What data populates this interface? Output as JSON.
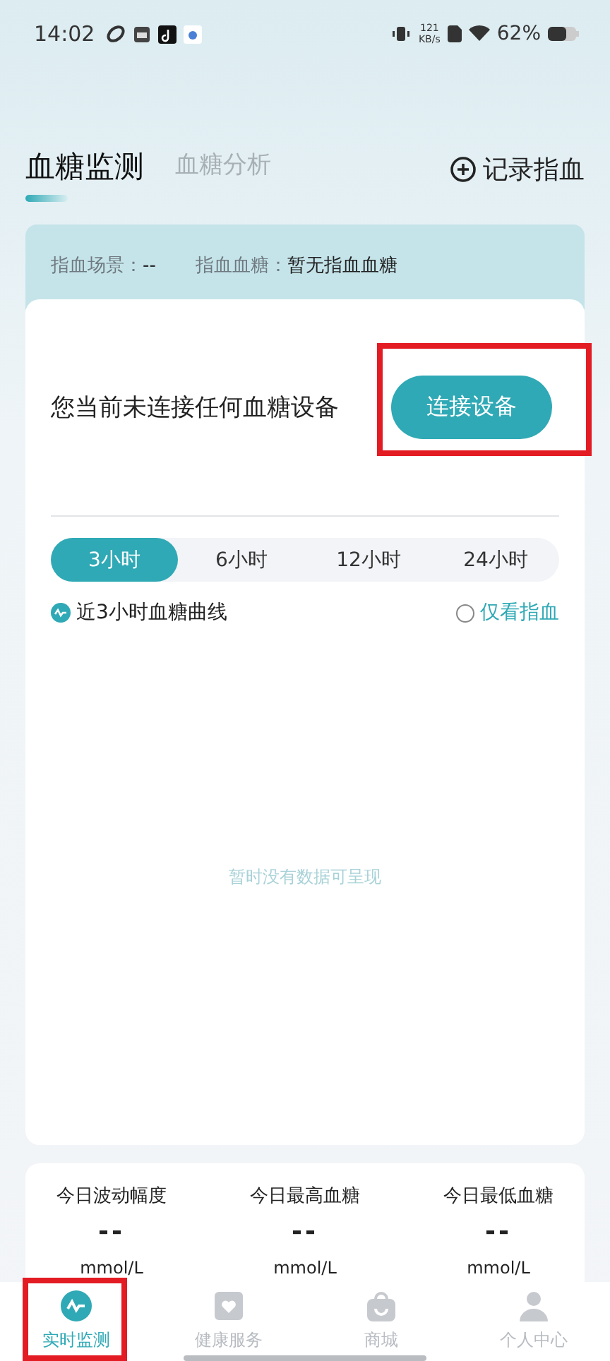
{
  "status_bar": {
    "time": "14:02",
    "speed_value": "121",
    "speed_unit": "KB/s",
    "battery": "62%"
  },
  "tabs": [
    {
      "label": "血糖监测",
      "selected": true
    },
    {
      "label": "血糖分析",
      "selected": false
    }
  ],
  "record_button": {
    "label": "记录指血"
  },
  "finger_info": [
    {
      "label": "指血场景：",
      "value": "--"
    },
    {
      "label": "指血血糖：",
      "value": "暂无指血血糖"
    }
  ],
  "device": {
    "message": "您当前未连接任何血糖设备",
    "connect_button": "连接设备",
    "highlighted": true
  },
  "ranges": [
    {
      "label": "3小时",
      "selected": true
    },
    {
      "label": "6小时",
      "selected": false
    },
    {
      "label": "12小时",
      "selected": false
    },
    {
      "label": "24小时",
      "selected": false
    }
  ],
  "curve_title": "近3小时血糖曲线",
  "finger_only": {
    "label": "仅看指血",
    "checked": false
  },
  "empty_message": "暂时没有数据可呈现",
  "stats": [
    {
      "label": "今日波动幅度",
      "value": "--",
      "unit": "mmol/L"
    },
    {
      "label": "今日最高血糖",
      "value": "--",
      "unit": "mmol/L"
    },
    {
      "label": "今日最低血糖",
      "value": "--",
      "unit": "mmol/L"
    }
  ],
  "nav": [
    {
      "label": "实时监测",
      "selected": true,
      "highlighted": true
    },
    {
      "label": "健康服务",
      "selected": false,
      "highlighted": false
    },
    {
      "label": "商城",
      "selected": false,
      "highlighted": false
    },
    {
      "label": "个人中心",
      "selected": false,
      "highlighted": false
    }
  ]
}
